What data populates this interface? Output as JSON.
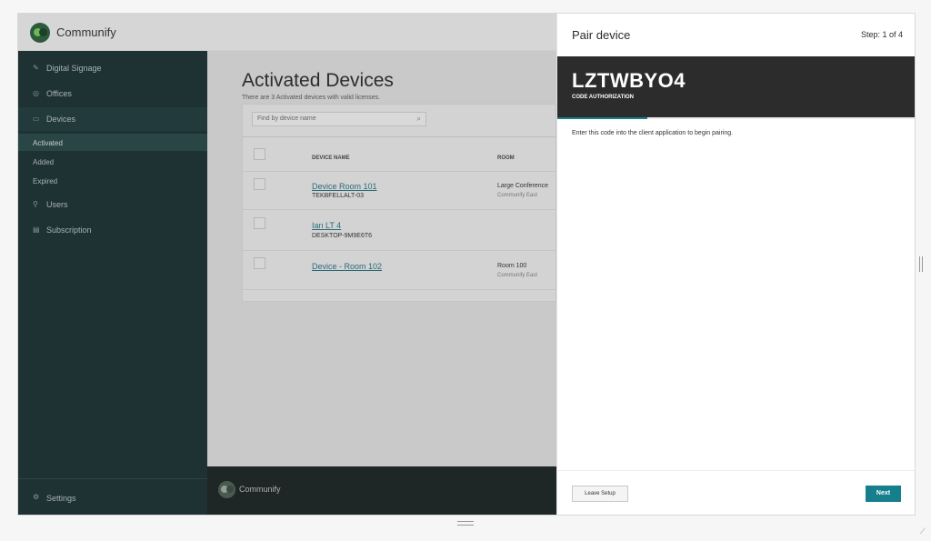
{
  "brand": "Communify",
  "sidebar": {
    "items": [
      {
        "label": "Digital Signage",
        "icon": "pencil-icon"
      },
      {
        "label": "Offices",
        "icon": "offices-icon"
      },
      {
        "label": "Devices",
        "icon": "devices-icon"
      }
    ],
    "sub_items": [
      {
        "label": "Activated",
        "active": true
      },
      {
        "label": "Added"
      },
      {
        "label": "Expired"
      }
    ],
    "items2": [
      {
        "label": "Users",
        "icon": "users-icon"
      },
      {
        "label": "Subscription",
        "icon": "subscription-icon"
      }
    ],
    "settings_label": "Settings"
  },
  "main": {
    "title": "Activated Devices",
    "subtitle": "There are 3 Activated devices with valid licenses.",
    "search_placeholder": "Find by device name",
    "columns": {
      "device_name": "DEVICE NAME",
      "room": "ROOM"
    },
    "rows": [
      {
        "name": "Device Room 101",
        "id": "TEKBFELLALT-03",
        "room": "Large Conference",
        "room_sub": "Communify East"
      },
      {
        "name": "Ian LT 4",
        "id": "DESKTOP-9M9E6T6",
        "room": "",
        "room_sub": ""
      },
      {
        "name": "Device - Room 102",
        "id": "",
        "room": "Room 100",
        "room_sub": "Communify East"
      }
    ]
  },
  "footer": {
    "brand": "Communify"
  },
  "pair": {
    "title": "Pair device",
    "step": "Step:  1 of 4",
    "step_progress": 0.25,
    "code": "LZTWBYO4",
    "code_label": "CODE AUTHORIZATION",
    "instruction": "Enter this code into the client application to begin pairing.",
    "leave_label": "Leave Setup",
    "next_label": "Next"
  },
  "colors": {
    "accent": "#157f8d",
    "sidebar": "#1e3133",
    "code_band": "#2c2c2c"
  }
}
